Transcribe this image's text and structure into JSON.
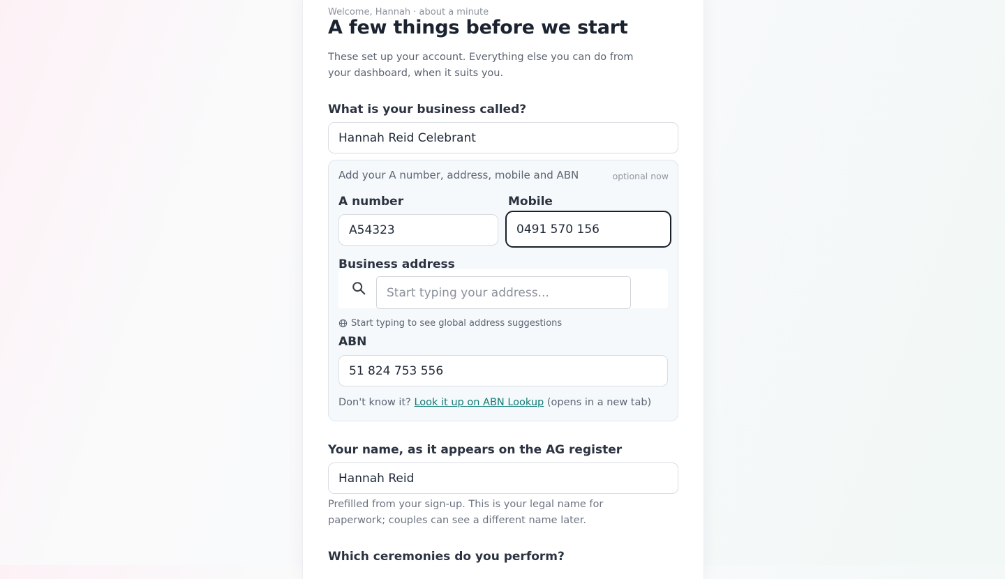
{
  "header": {
    "eyebrow": "Welcome, Hannah · about a minute",
    "title": "A few things before we start",
    "intro": "These set up your account. Everything else you can do from your dashboard, when it suits you."
  },
  "business_name": {
    "label": "What is your business called?",
    "value": "Hannah Reid Celebrant"
  },
  "details_panel": {
    "title": "Add your A number, address, mobile and ABN",
    "badge": "optional now",
    "a_number": {
      "label": "A number",
      "value": "A54323"
    },
    "mobile": {
      "label": "Mobile",
      "value": "0491 570 156"
    },
    "address": {
      "label": "Business address",
      "placeholder": "Start typing your address...",
      "hint": "Start typing to see global address suggestions",
      "search_icon": "search-icon",
      "hint_icon": "globe-icon"
    },
    "abn": {
      "label": "ABN",
      "value": "51 824 753 556",
      "help_prefix": "Don't know it?",
      "help_link": "Look it up on ABN Lookup",
      "help_suffix": "(opens in a new tab)"
    }
  },
  "register_name": {
    "label": "Your name, as it appears on the AG register",
    "value": "Hannah Reid",
    "help": "Prefilled from your sign-up. This is your legal name for paperwork; couples can see a different name later."
  },
  "ceremonies": {
    "label": "Which ceremonies do you perform?"
  },
  "colors": {
    "accent_link": "#0f7a74",
    "focus_border": "#1a1f29",
    "panel_bg": "#f5f9fb"
  }
}
